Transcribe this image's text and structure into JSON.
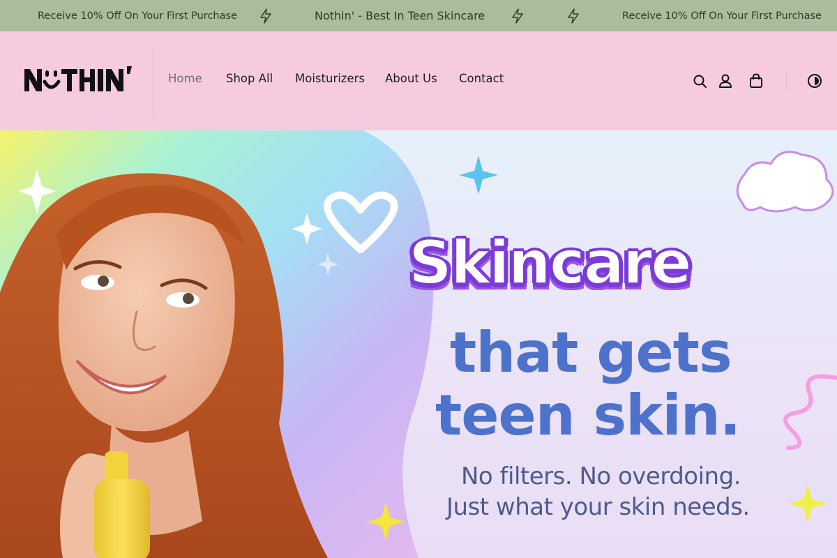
{
  "announcement": {
    "messages": [
      "Receive 10% Off On Your First Purchase",
      "Nothin' - Best In Teen Skincare",
      "Receive 10% Off On Your First Purchase"
    ],
    "divider_icon": "lightning-bolt-icon"
  },
  "header": {
    "logo_text": "NOTHIN'",
    "nav": [
      {
        "label": "Home",
        "active": true
      },
      {
        "label": "Shop All",
        "active": false
      },
      {
        "label": "Moisturizers",
        "active": false
      },
      {
        "label": "About Us",
        "active": false
      },
      {
        "label": "Contact",
        "active": false
      }
    ],
    "icons": [
      "search-icon",
      "account-icon",
      "cart-icon",
      "theme-toggle-icon"
    ]
  },
  "hero": {
    "headline": "Skincare",
    "line2": "that gets",
    "line3": "teen skin.",
    "sub1": "No filters. No overdoing.",
    "sub2": "Just what your skin needs."
  },
  "colors": {
    "announcement_bg": "#a9bc9c",
    "header_bg": "#f6cbe0",
    "headline_purple": "#7a3bd8",
    "headline_blue": "#4d72cc"
  }
}
